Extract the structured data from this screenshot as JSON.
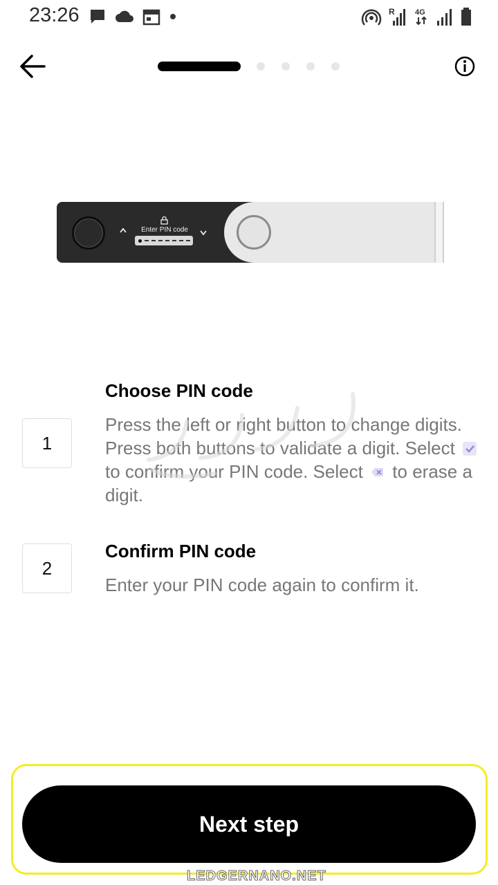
{
  "status_bar": {
    "time": "23:26",
    "left_icons": [
      "message-icon",
      "cloud-icon",
      "calendar-icon",
      "dot-icon"
    ],
    "right_icons": [
      "hotspot-icon",
      "signal-roaming-icon",
      "network-4g-icon",
      "signal-icon",
      "battery-icon"
    ],
    "roaming_label": "R",
    "network_label": "4G"
  },
  "header": {
    "back_icon": "arrow-left-icon",
    "info_icon": "info-icon",
    "progress": {
      "current_step": 1,
      "total_steps": 5
    }
  },
  "device": {
    "screen_label": "Enter PIN code",
    "lock_icon": "lock-icon"
  },
  "steps": [
    {
      "number": "1",
      "title": "Choose PIN code",
      "body_part1": "Press the left or right button to change digits. Press both buttons to validate a digit. Select",
      "body_part2": "to confirm your PIN code. Select",
      "body_part3": "to erase a digit."
    },
    {
      "number": "2",
      "title": "Confirm PIN code",
      "body": "Enter your PIN code again to confirm it."
    }
  ],
  "footer": {
    "next_label": "Next step",
    "watermark": "LEDGERNANO.NET"
  },
  "colors": {
    "accent": "#000000",
    "highlight": "#f4ec25",
    "body_text": "#777777"
  }
}
